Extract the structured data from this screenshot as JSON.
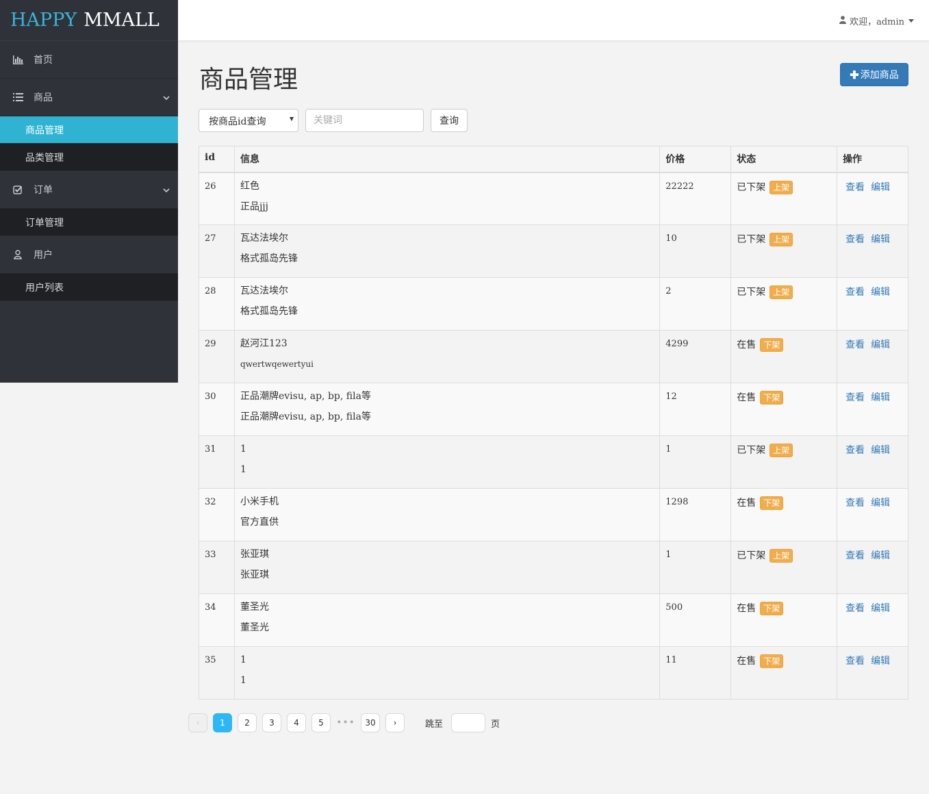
{
  "brand": {
    "part1": "HAPPY",
    "part2": "MMALL"
  },
  "header": {
    "user_text": "欢迎，admin"
  },
  "sidebar": {
    "home": "首页",
    "product": "商品",
    "product_manage": "商品管理",
    "category_manage": "品类管理",
    "order": "订单",
    "order_manage": "订单管理",
    "user": "用户",
    "user_list": "用户列表"
  },
  "page": {
    "title": "商品管理",
    "add_label": "添加商品"
  },
  "search": {
    "type_selected": "按商品id查询",
    "placeholder": "关键词",
    "button": "查询"
  },
  "table": {
    "headers": [
      "id",
      "信息",
      "价格",
      "状态",
      "操作"
    ],
    "view_label": "查看",
    "edit_label": "编辑",
    "rows": [
      {
        "id": "26",
        "name": "红色",
        "subtitle": "正品jjj",
        "price": "22222",
        "status": "已下架",
        "action": "上架"
      },
      {
        "id": "27",
        "name": "瓦达法埃尔",
        "subtitle": "格式孤岛先锋",
        "price": "10",
        "status": "已下架",
        "action": "上架"
      },
      {
        "id": "28",
        "name": "瓦达法埃尔",
        "subtitle": "格式孤岛先锋",
        "price": "2",
        "status": "已下架",
        "action": "上架"
      },
      {
        "id": "29",
        "name": "赵河江123",
        "subtitle": "qwertwqewertyui",
        "price": "4299",
        "status": "在售",
        "action": "下架"
      },
      {
        "id": "30",
        "name": "正品潮牌evisu, ap, bp, fila等",
        "subtitle": "正品潮牌evisu, ap, bp, fila等",
        "price": "12",
        "status": "在售",
        "action": "下架"
      },
      {
        "id": "31",
        "name": "1",
        "subtitle": "1",
        "price": "1",
        "status": "已下架",
        "action": "上架"
      },
      {
        "id": "32",
        "name": "小米手机",
        "subtitle": "官方直供",
        "price": "1298",
        "status": "在售",
        "action": "下架"
      },
      {
        "id": "33",
        "name": "张亚琪",
        "subtitle": "张亚琪",
        "price": "1",
        "status": "已下架",
        "action": "上架"
      },
      {
        "id": "34",
        "name": "董圣光",
        "subtitle": "董圣光",
        "price": "500",
        "status": "在售",
        "action": "下架"
      },
      {
        "id": "35",
        "name": "1",
        "subtitle": "1",
        "price": "11",
        "status": "在售",
        "action": "下架"
      }
    ]
  },
  "pagination": {
    "prev": "‹",
    "next": "›",
    "pages": [
      "1",
      "2",
      "3",
      "4",
      "5"
    ],
    "dots": "•••",
    "last": "30",
    "current": "1",
    "jump_prefix": "跳至",
    "jump_suffix": "页"
  }
}
